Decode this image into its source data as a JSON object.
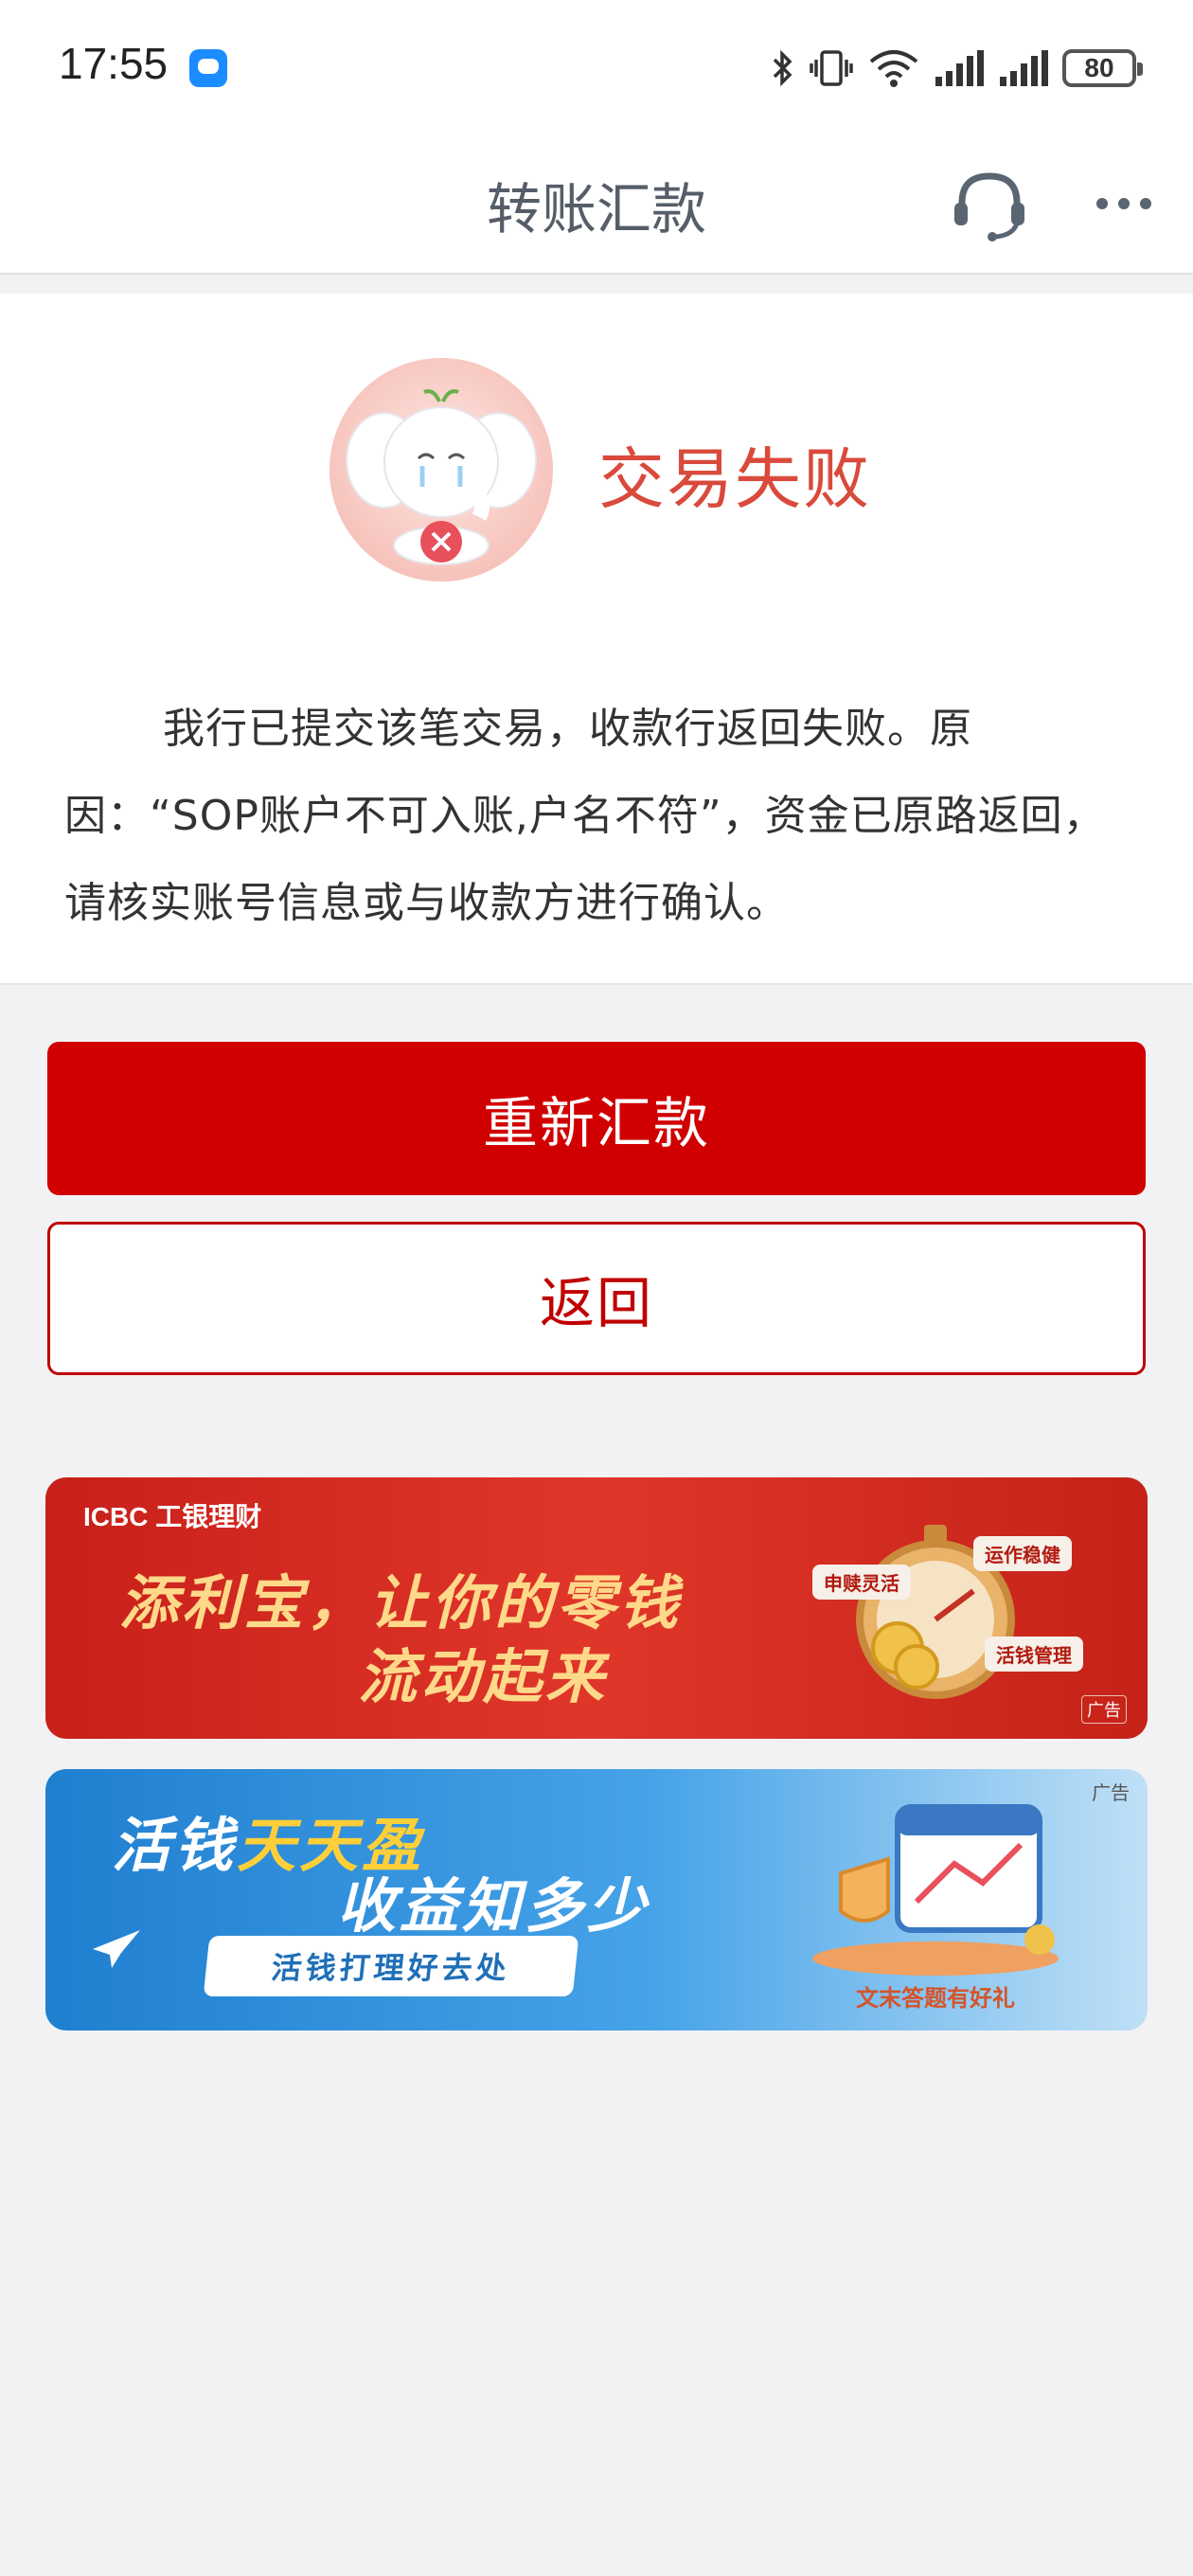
{
  "status_bar": {
    "time": "17:55",
    "battery": "80",
    "icons": [
      "message-app-icon",
      "bluetooth-icon",
      "vibrate-icon",
      "wifi-icon",
      "signal-icon",
      "signal-icon",
      "battery-icon"
    ]
  },
  "nav": {
    "title": "转账汇款",
    "icons": [
      "headset-icon",
      "more-icon"
    ]
  },
  "result": {
    "title": "交易失败",
    "message": "我行已提交该笔交易，收款行返回失败。原因：“SOP账户不可入账,户名不符”，资金已原路返回，请核实账号信息或与收款方进行确认。",
    "colors": {
      "title": "#d94a3c"
    }
  },
  "actions": {
    "retry_label": "重新汇款",
    "back_label": "返回",
    "colors": {
      "primary": "#d00000"
    }
  },
  "banners": [
    {
      "brand": "ICBC 工银理财",
      "line1": "添利宝，让你的零钱",
      "line2": "流动起来",
      "tags": [
        "申赎灵活",
        "运作稳健",
        "活钱管理"
      ],
      "ad_label": "广告"
    },
    {
      "line1_prefix": "活钱",
      "line1_highlight": "天天盈",
      "line2": "收益知多少",
      "pill": "活钱打理好去处",
      "footer": "文末答题有好礼",
      "ad_label": "广告"
    }
  ]
}
